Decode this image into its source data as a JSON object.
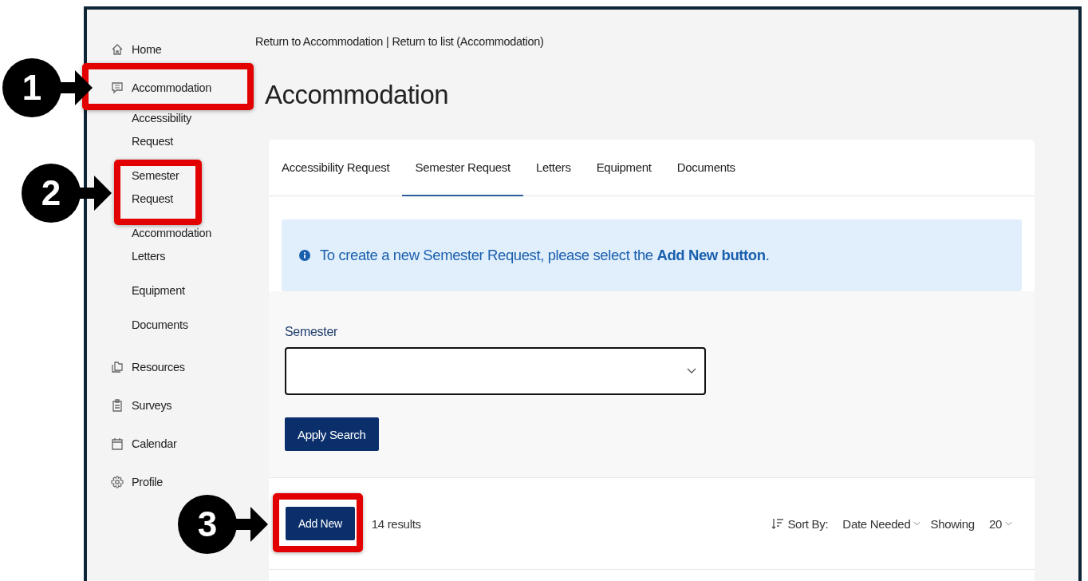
{
  "breadcrumb": {
    "links": [
      "Return to Accommodation",
      "Return to list (Accommodation)"
    ],
    "separator": "|"
  },
  "sidebar": {
    "items": [
      {
        "label": "Home"
      },
      {
        "label": "Accommodation",
        "children": [
          {
            "label": "Accessibility Request"
          },
          {
            "label": "Semester Request"
          },
          {
            "label": "Accommodation Letters"
          },
          {
            "label": "Equipment"
          },
          {
            "label": "Documents"
          }
        ]
      },
      {
        "label": "Resources"
      },
      {
        "label": "Surveys"
      },
      {
        "label": "Calendar"
      },
      {
        "label": "Profile"
      }
    ]
  },
  "page_title": "Accommodation",
  "tabs": [
    {
      "label": "Accessibility Request",
      "selected": false
    },
    {
      "label": "Semester Request",
      "selected": true
    },
    {
      "label": "Letters",
      "selected": false
    },
    {
      "label": "Equipment",
      "selected": false
    },
    {
      "label": "Documents",
      "selected": false
    }
  ],
  "alert": {
    "text": "To create a new Semester Request, please select the **Add New button**."
  },
  "filter": {
    "label": "Semester",
    "button": "Apply Search"
  },
  "results": {
    "add_button": "Add New",
    "count": "14 results",
    "sort_label": "Sort By:",
    "sort_value": "Date Needed",
    "showing_label": "Showing",
    "showing_value": "20"
  },
  "callouts": [
    {
      "number": "1"
    },
    {
      "number": "2"
    },
    {
      "number": "3"
    }
  ]
}
